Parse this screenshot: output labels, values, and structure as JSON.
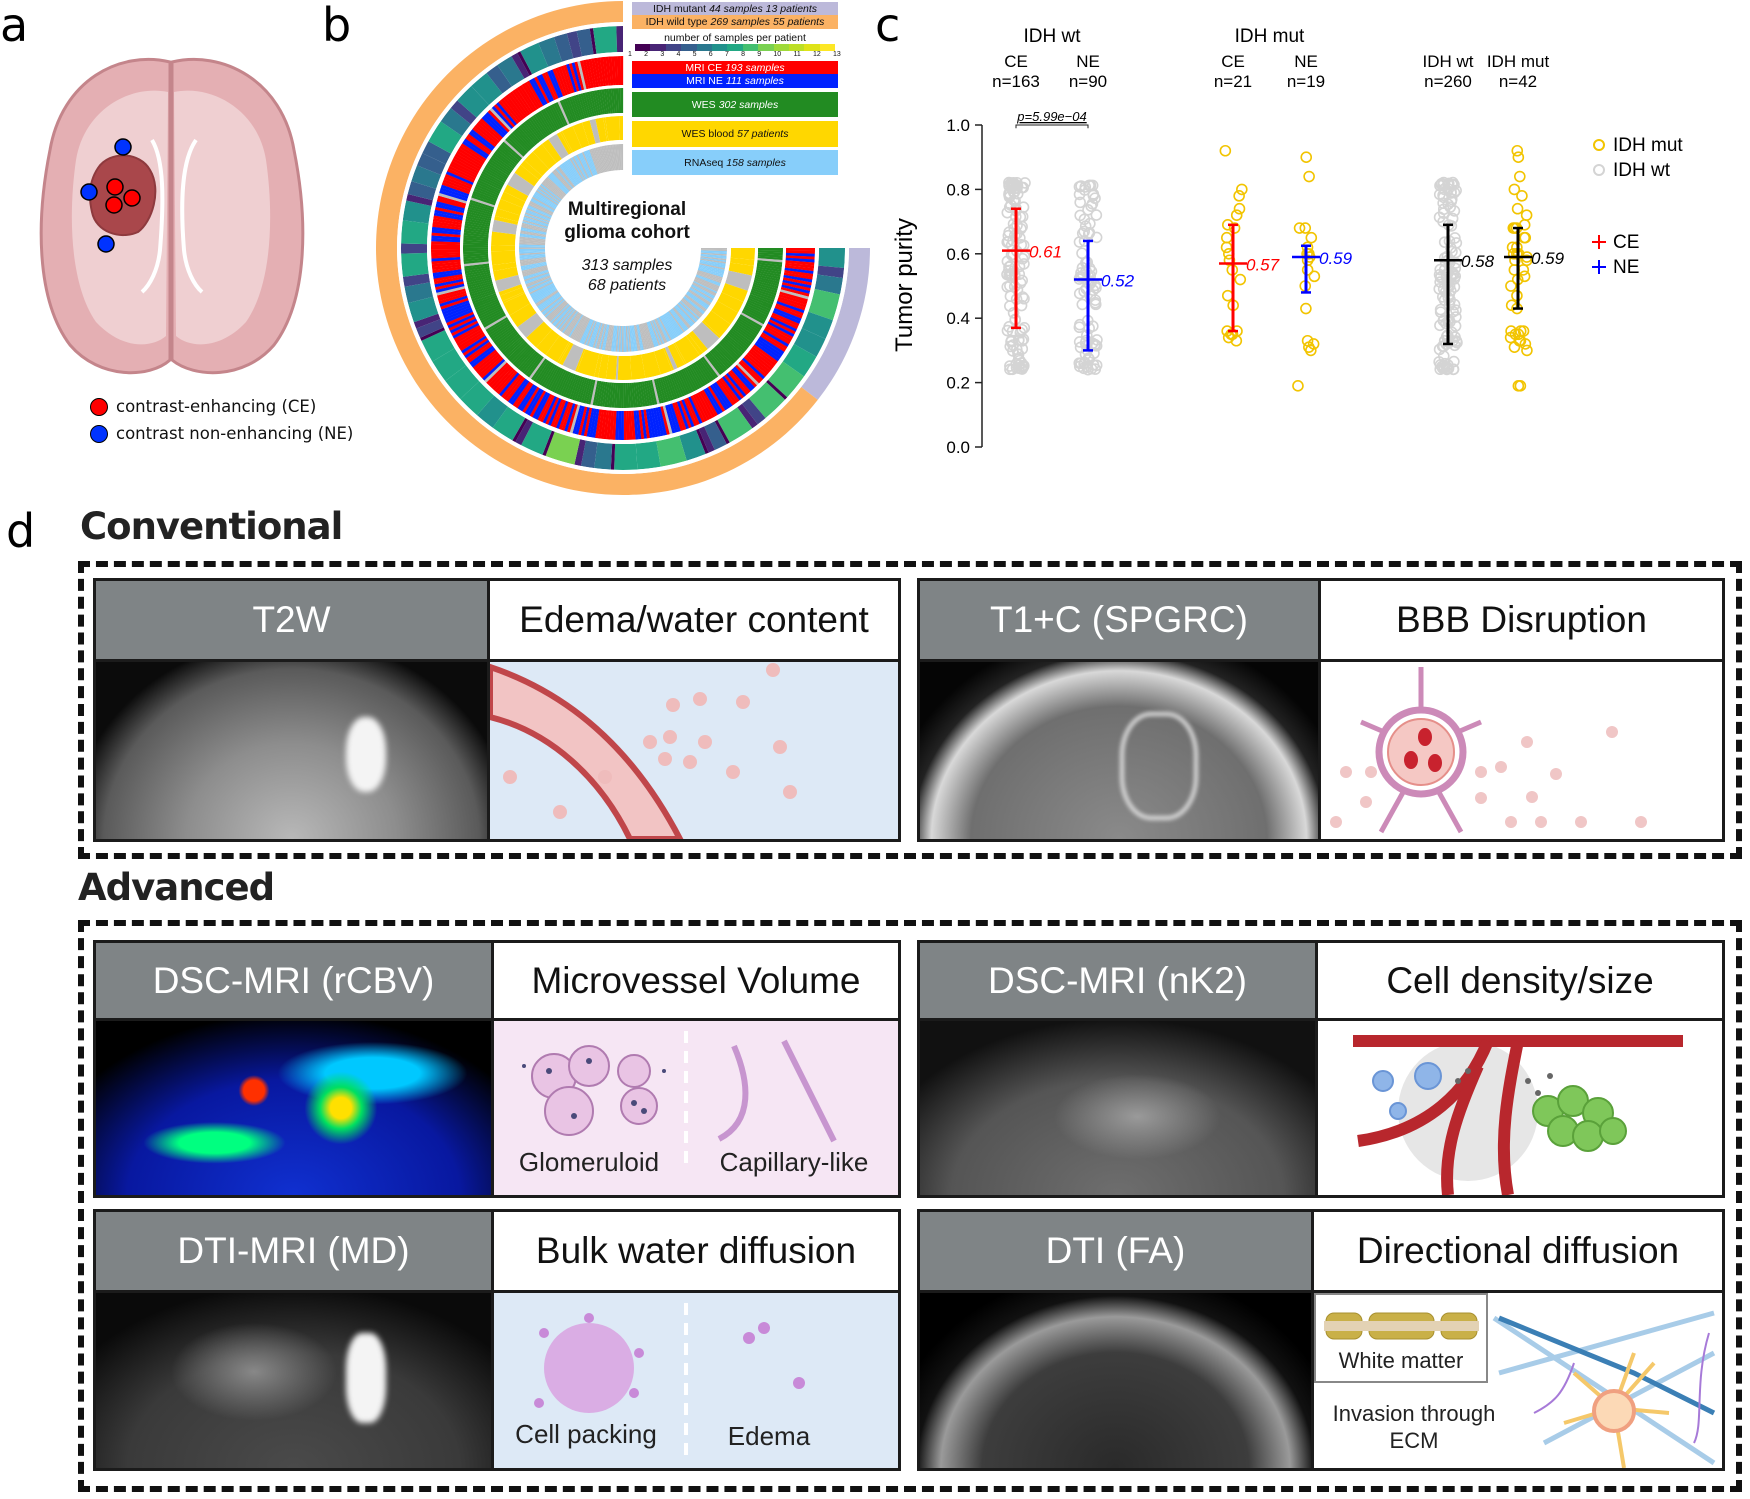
{
  "panel_labels": {
    "a": "a",
    "b": "b",
    "c": "c",
    "d": "d"
  },
  "panel_a": {
    "legend": [
      {
        "label": "contrast-enhancing (CE)",
        "color": "#ff0000"
      },
      {
        "label": "contrast non-enhancing (NE)",
        "color": "#0033ff"
      }
    ]
  },
  "panel_b": {
    "center_title_line1": "Multiregional",
    "center_title_line2": "glioma cohort",
    "center_samples": "313 samples",
    "center_patients": "68 patients",
    "legend": [
      {
        "label": "IDH mutant",
        "detail": "44 samples 13 patients",
        "color": "#bcb9da",
        "text_color": "#111"
      },
      {
        "label": "IDH wild type",
        "detail": "269 samples 55 patients",
        "color": "#fbb264",
        "text_color": "#111"
      },
      {
        "label": "MRI CE",
        "detail": "193 samples",
        "color": "#ff0000",
        "text_color": "#fff"
      },
      {
        "label": "MRI NE",
        "detail": "111 samples",
        "color": "#0022ff",
        "text_color": "#fff"
      },
      {
        "label": "WES",
        "detail": "302 samples",
        "color": "#228b22",
        "text_color": "#fff"
      },
      {
        "label": "WES blood",
        "detail": "57 patients",
        "color": "#ffd700",
        "text_color": "#111"
      },
      {
        "label": "RNAseq",
        "detail": "158 samples",
        "color": "#87cefa",
        "text_color": "#111"
      }
    ],
    "colorbar_title": "number of samples per patient",
    "colorbar_ticks": [
      "1",
      "2",
      "3",
      "4",
      "5",
      "6",
      "7",
      "8",
      "9",
      "10",
      "11",
      "12",
      "13"
    ],
    "colorbar_colors": [
      "#440154",
      "#482475",
      "#414487",
      "#355f8d",
      "#2a788e",
      "#21918c",
      "#22a884",
      "#44bf70",
      "#7ad151",
      "#9fda3a",
      "#bddf26",
      "#dfe318",
      "#fde725"
    ],
    "missing_color": "#bebebe"
  },
  "chart_data": {
    "type": "scatter",
    "ylabel": "Tumor purity",
    "ylim": [
      0.0,
      1.0
    ],
    "yticks": [
      "0.0",
      "0.2",
      "0.4",
      "0.6",
      "0.8",
      "1.0"
    ],
    "header_groups": [
      "IDH wt",
      "IDH mut"
    ],
    "pvalue": "p=5.99e−04",
    "groups": [
      {
        "label": "CE",
        "n_label": "n=163",
        "n": 163,
        "mean": 0.61,
        "mean_label": "0.61",
        "lower": 0.37,
        "upper": 0.74,
        "bar_color": "#ff0000",
        "point_color": "#d4d4d4",
        "range": [
          0.16,
          0.91
        ]
      },
      {
        "label": "NE",
        "n_label": "n=90",
        "n": 90,
        "mean": 0.52,
        "mean_label": "0.52",
        "lower": 0.3,
        "upper": 0.64,
        "bar_color": "#0000ff",
        "point_color": "#d4d4d4",
        "range": [
          0.16,
          0.9
        ]
      },
      {
        "label": "CE",
        "n_label": "n=21",
        "n": 21,
        "mean": 0.57,
        "mean_label": "0.57",
        "lower": 0.36,
        "upper": 0.69,
        "bar_color": "#ff0000",
        "point_color": "#f2c400",
        "points": [
          0.92,
          0.8,
          0.78,
          0.74,
          0.72,
          0.69,
          0.68,
          0.65,
          0.62,
          0.6,
          0.58,
          0.55,
          0.52,
          0.47,
          0.44,
          0.36,
          0.36,
          0.35,
          0.35,
          0.34,
          0.33
        ]
      },
      {
        "label": "NE",
        "n_label": "n=19",
        "n": 19,
        "mean": 0.59,
        "mean_label": "0.59",
        "lower": 0.48,
        "upper": 0.625,
        "bar_color": "#0000ff",
        "point_color": "#f2c400",
        "points": [
          0.9,
          0.84,
          0.68,
          0.68,
          0.65,
          0.62,
          0.6,
          0.6,
          0.59,
          0.58,
          0.55,
          0.53,
          0.5,
          0.43,
          0.33,
          0.32,
          0.31,
          0.3,
          0.19
        ]
      },
      {
        "label": "IDH wt",
        "n_label": "n=260",
        "n": 260,
        "mean": 0.58,
        "mean_label": "0.58",
        "lower": 0.32,
        "upper": 0.69,
        "bar_color": "#000000",
        "point_color": "#d4d4d4",
        "range": [
          0.16,
          0.91
        ]
      },
      {
        "label": "IDH mut",
        "n_label": "n=42",
        "n": 42,
        "mean": 0.59,
        "mean_label": "0.59",
        "lower": 0.43,
        "upper": 0.68,
        "bar_color": "#000000",
        "point_color": "#f2c400",
        "points": [
          0.92,
          0.9,
          0.84,
          0.8,
          0.78,
          0.74,
          0.72,
          0.69,
          0.68,
          0.68,
          0.68,
          0.65,
          0.65,
          0.62,
          0.62,
          0.6,
          0.6,
          0.6,
          0.59,
          0.58,
          0.58,
          0.55,
          0.55,
          0.53,
          0.52,
          0.5,
          0.47,
          0.44,
          0.43,
          0.36,
          0.36,
          0.35,
          0.35,
          0.34,
          0.33,
          0.33,
          0.32,
          0.31,
          0.3,
          0.19,
          0.19,
          0.36
        ]
      }
    ],
    "legend": [
      {
        "label": "IDH mut",
        "marker": "circle",
        "color": "#f2c400"
      },
      {
        "label": "IDH wt",
        "marker": "circle",
        "color": "#d4d4d4"
      },
      {
        "label": "CE",
        "marker": "cross",
        "color": "#ff0000"
      },
      {
        "label": "NE",
        "marker": "cross",
        "color": "#0000ff"
      }
    ],
    "legend_position": "right",
    "grid": false
  },
  "panel_d": {
    "conventional_title": "Conventional",
    "advanced_title": "Advanced",
    "pairs": [
      {
        "modality": "T2W",
        "concept": "Edema/water content"
      },
      {
        "modality": "T1+C (SPGRC)",
        "concept": "BBB Disruption"
      },
      {
        "modality": "DSC-MRI (rCBV)",
        "concept": "Microvessel Volume",
        "sublabels": [
          "Glomeruloid",
          "Capillary-like"
        ]
      },
      {
        "modality": "DSC-MRI (nK2)",
        "concept": "Cell density/size"
      },
      {
        "modality": "DTI-MRI (MD)",
        "concept": "Bulk water diffusion",
        "sublabels": [
          "Cell packing",
          "Edema"
        ]
      },
      {
        "modality": "DTI (FA)",
        "concept": "Directional diffusion",
        "sublabels": [
          "White matter",
          "Invasion through",
          "ECM"
        ]
      }
    ]
  }
}
